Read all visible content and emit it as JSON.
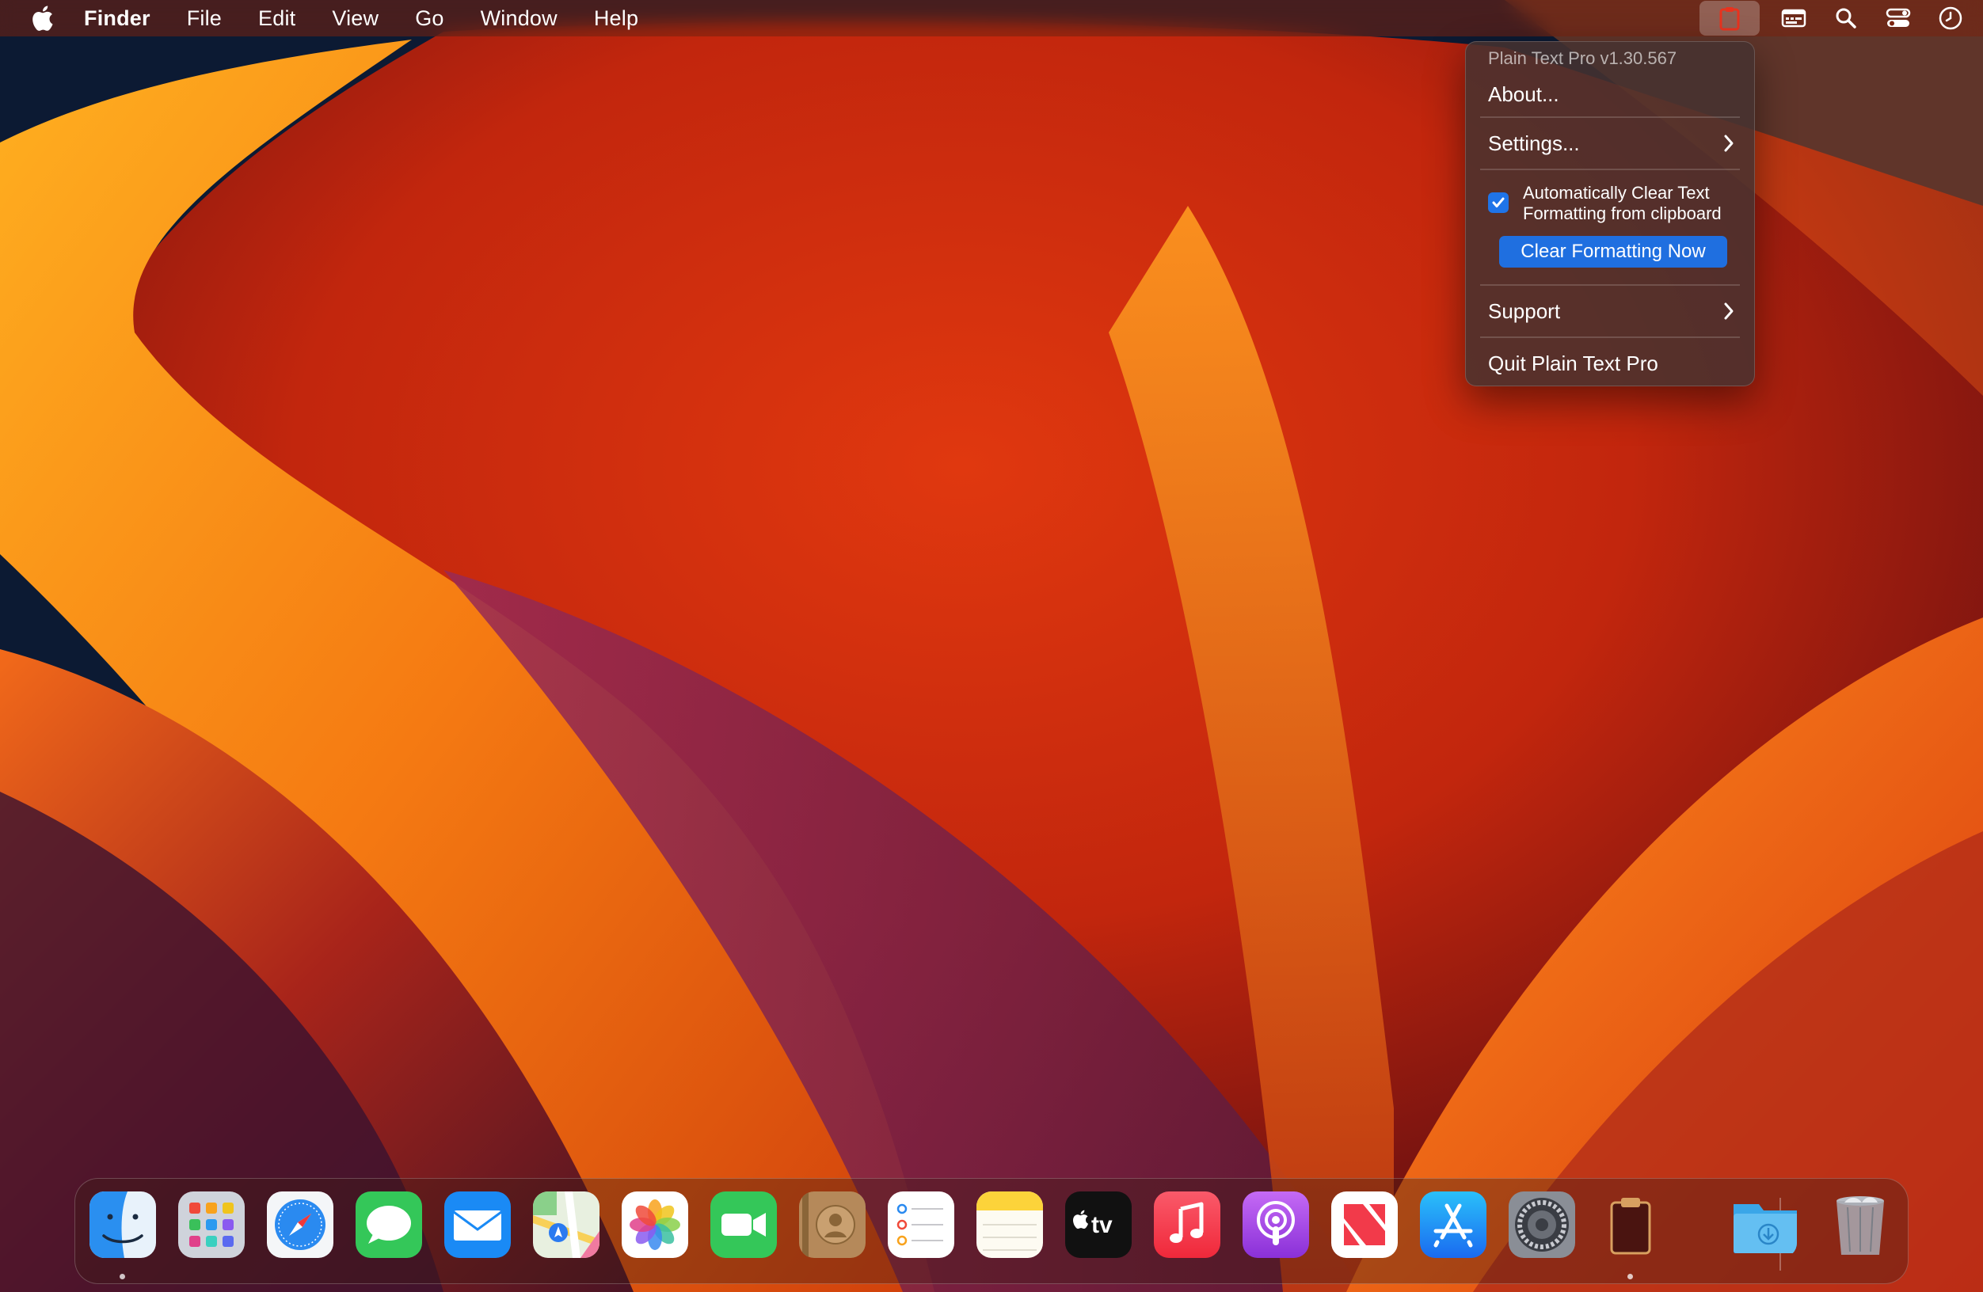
{
  "menubar": {
    "app_name": "Finder",
    "items": [
      "File",
      "Edit",
      "View",
      "Go",
      "Window",
      "Help"
    ],
    "status_icons": [
      "clipboard-icon",
      "keyboard-viewer-icon",
      "search-icon",
      "control-center-icon",
      "clock-icon"
    ]
  },
  "dropdown": {
    "header": "Plain Text Pro v1.30.567",
    "about": "About...",
    "settings": "Settings...",
    "auto_clear_label": "Automatically Clear Text Formatting from clipboard",
    "auto_clear_checked": true,
    "clear_button": "Clear Formatting Now",
    "support": "Support",
    "quit": "Quit Plain Text Pro"
  },
  "dock": {
    "apps": [
      "Finder",
      "Launchpad",
      "Safari",
      "Messages",
      "Mail",
      "Maps",
      "Photos",
      "FaceTime",
      "Contacts",
      "Reminders",
      "Notes",
      "Apple TV",
      "Music",
      "Podcasts",
      "News",
      "App Store",
      "System Settings",
      "Plain Text Pro",
      "Downloads",
      "Trash"
    ],
    "running": [
      "Finder",
      "Plain Text Pro"
    ]
  },
  "colors": {
    "accent": "#1f6fe0",
    "menubar": "#7a2410",
    "wallpaper_orange": "#f58a12",
    "wallpaper_red": "#c8240c",
    "wallpaper_dark": "#0c1a33"
  }
}
